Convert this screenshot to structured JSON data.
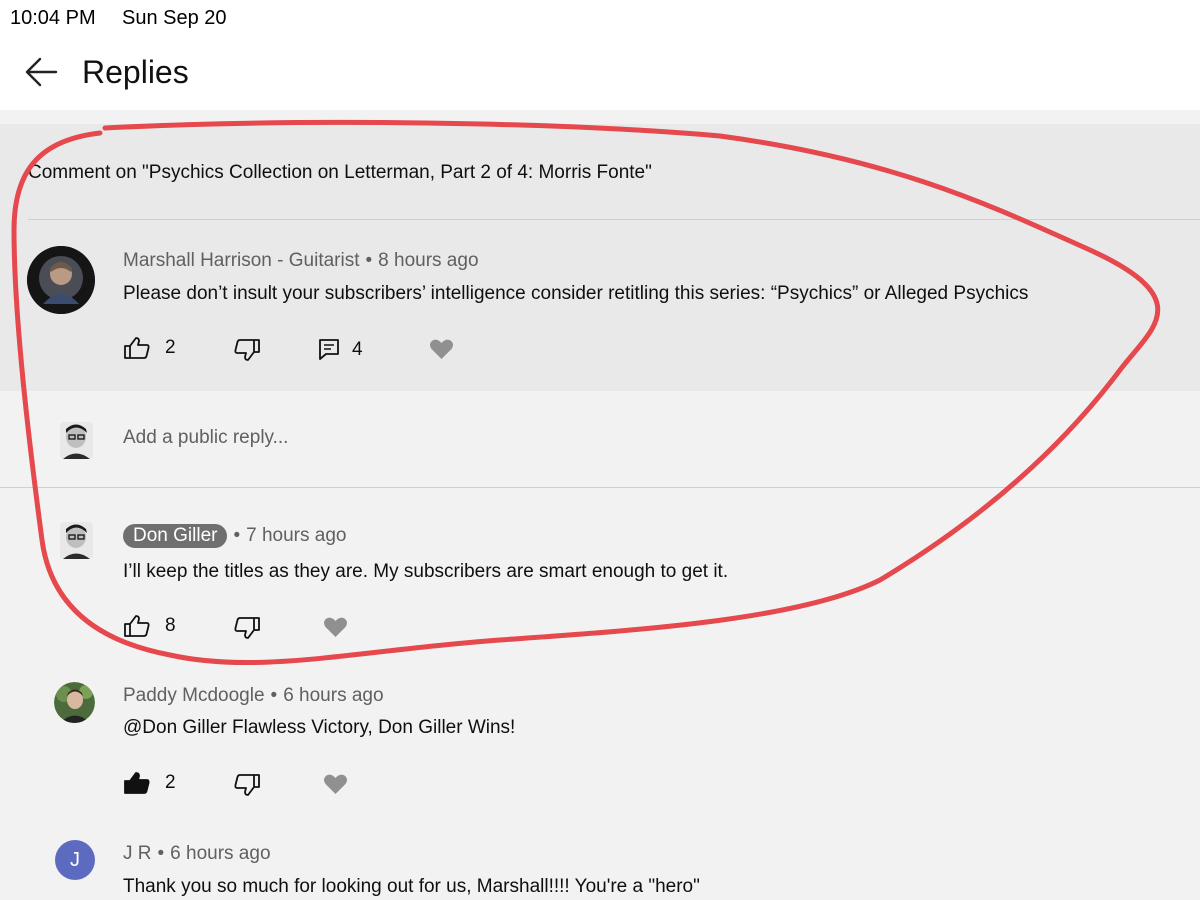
{
  "status_bar": {
    "time": "10:04 PM",
    "date": "Sun Sep 20"
  },
  "header": {
    "title": "Replies",
    "back_icon": "arrow-left-icon"
  },
  "context": {
    "text": "Comment on \"Psychics Collection on Letterman, Part 2 of 4: Morris Fonte\""
  },
  "main_comment": {
    "author": "Marshall Harrison - Guitarist",
    "time": "8 hours ago",
    "text": "Please don’t insult your subscribers’ intelligence consider retitling this series: “Psychics” or  Alleged Psychics",
    "likes": "2",
    "replies": "4"
  },
  "reply_box": {
    "placeholder": "Add a public reply..."
  },
  "replies": [
    {
      "author": "Don Giller",
      "time": "7 hours ago",
      "text": "I’ll keep the titles as they are. My subscribers are smart enough to get it.",
      "likes": "8",
      "is_creator": true
    },
    {
      "author": "Paddy Mcdoogle",
      "time": "6 hours ago",
      "text": "@Don Giller Flawless Victory, Don Giller Wins!",
      "likes": "2",
      "liked": true
    },
    {
      "author": "J R",
      "avatar_letter": "J",
      "time": "6 hours ago",
      "text": "Thank you so much for looking out for us, Marshall!!!! You're a \"hero\""
    }
  ],
  "separator": "•",
  "icons": [
    "arrow-left-icon",
    "thumbs-up-icon",
    "thumbs-down-icon",
    "reply-comment-icon",
    "heart-icon"
  ],
  "colors": {
    "annotation": "#e5484d",
    "creator_chip": "#6f6f6f",
    "jr_avatar": "#5c6bc0",
    "heart": "#909090"
  }
}
